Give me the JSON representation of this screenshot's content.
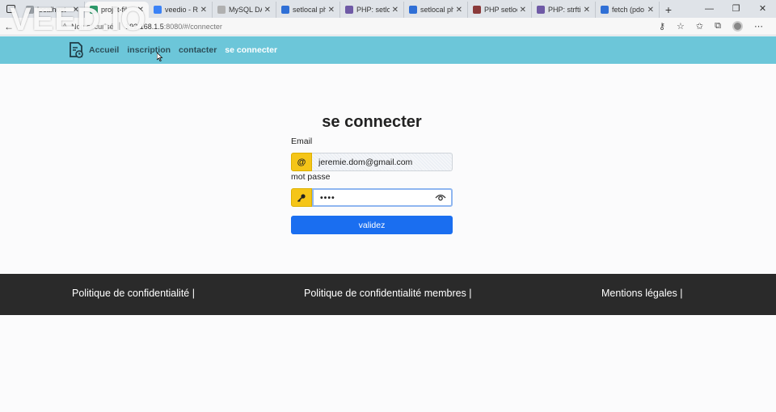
{
  "browser": {
    "tabs": [
      {
        "label": "localhost",
        "fav": "#9aa0a6",
        "active": false
      },
      {
        "label": "projet-fil",
        "fav": "#2e9b6b",
        "active": true
      },
      {
        "label": "veedio - Re",
        "fav": "#3b82f6",
        "active": false
      },
      {
        "label": "MySQL DA",
        "fav": "#b0b0b0",
        "active": false
      },
      {
        "label": "setlocal ph",
        "fav": "#2f6fd6",
        "active": false
      },
      {
        "label": "PHP: setloc",
        "fav": "#6f5aa6",
        "active": false
      },
      {
        "label": "setlocal ph",
        "fav": "#2f6fd6",
        "active": false
      },
      {
        "label": "PHP setloc",
        "fav": "#8a3a3a",
        "active": false
      },
      {
        "label": "PHP: strfti",
        "fav": "#6f5aa6",
        "active": false
      },
      {
        "label": "fetch (pdo",
        "fav": "#2f6fd6",
        "active": false
      }
    ],
    "security_label": "Non sécurisé",
    "url_host": "192.168.1.5",
    "url_path": ":8080/#/connecter",
    "watermark": "VEED.IO"
  },
  "nav": {
    "links": [
      {
        "label": "Accueil",
        "active": false
      },
      {
        "label": "inscription",
        "active": false
      },
      {
        "label": "contacter",
        "active": false
      },
      {
        "label": "se connecter",
        "active": true
      }
    ]
  },
  "login": {
    "title": "se connecter",
    "email_label": "Email",
    "email_addon": "@",
    "email_value": "jeremie.dom@gmail.com",
    "password_label": "mot passe",
    "password_value": "••••",
    "submit_label": "validez"
  },
  "footer": {
    "links": [
      "Politique de confidentialité |",
      "Politique de confidentialité membres |",
      "Mentions légales |"
    ]
  },
  "colors": {
    "nav_bg": "#6cc6d9",
    "addon_bg": "#f5c518",
    "button_bg": "#1a6ef0",
    "footer_bg": "#2a2a2a"
  }
}
